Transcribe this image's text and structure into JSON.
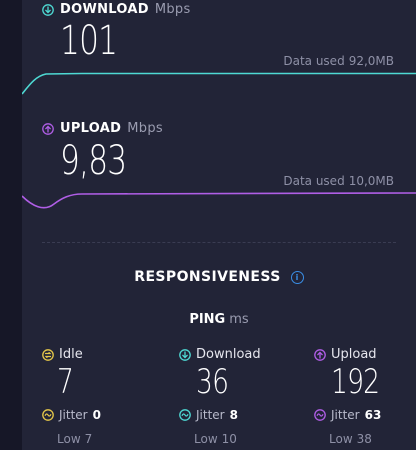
{
  "download": {
    "label": "DOWNLOAD",
    "unit": "Mbps",
    "value": "101",
    "data_used_label": "Data used",
    "data_used_value": "92,0MB",
    "color": "#4ed9d3",
    "icon": "download-arrow-icon"
  },
  "upload": {
    "label": "UPLOAD",
    "unit": "Mbps",
    "value": "9,83",
    "data_used_label": "Data used",
    "data_used_value": "10,0MB",
    "color": "#b05ee6",
    "icon": "upload-arrow-icon"
  },
  "responsiveness": {
    "title": "RESPONSIVENESS",
    "info_icon": "info-icon",
    "ping_label": "PING",
    "ping_unit": "ms"
  },
  "ping": {
    "idle": {
      "label": "Idle",
      "value": "7",
      "jitter_label": "Jitter",
      "jitter_value": "0",
      "low_label": "Low",
      "low_value": "7",
      "color": "#e6c84a"
    },
    "download": {
      "label": "Download",
      "value": "36",
      "jitter_label": "Jitter",
      "jitter_value": "8",
      "low_label": "Low",
      "low_value": "10",
      "color": "#4ed9d3"
    },
    "upload": {
      "label": "Upload",
      "value": "192",
      "jitter_label": "Jitter",
      "jitter_value": "63",
      "low_label": "Low",
      "low_value": "38",
      "color": "#b05ee6"
    }
  }
}
